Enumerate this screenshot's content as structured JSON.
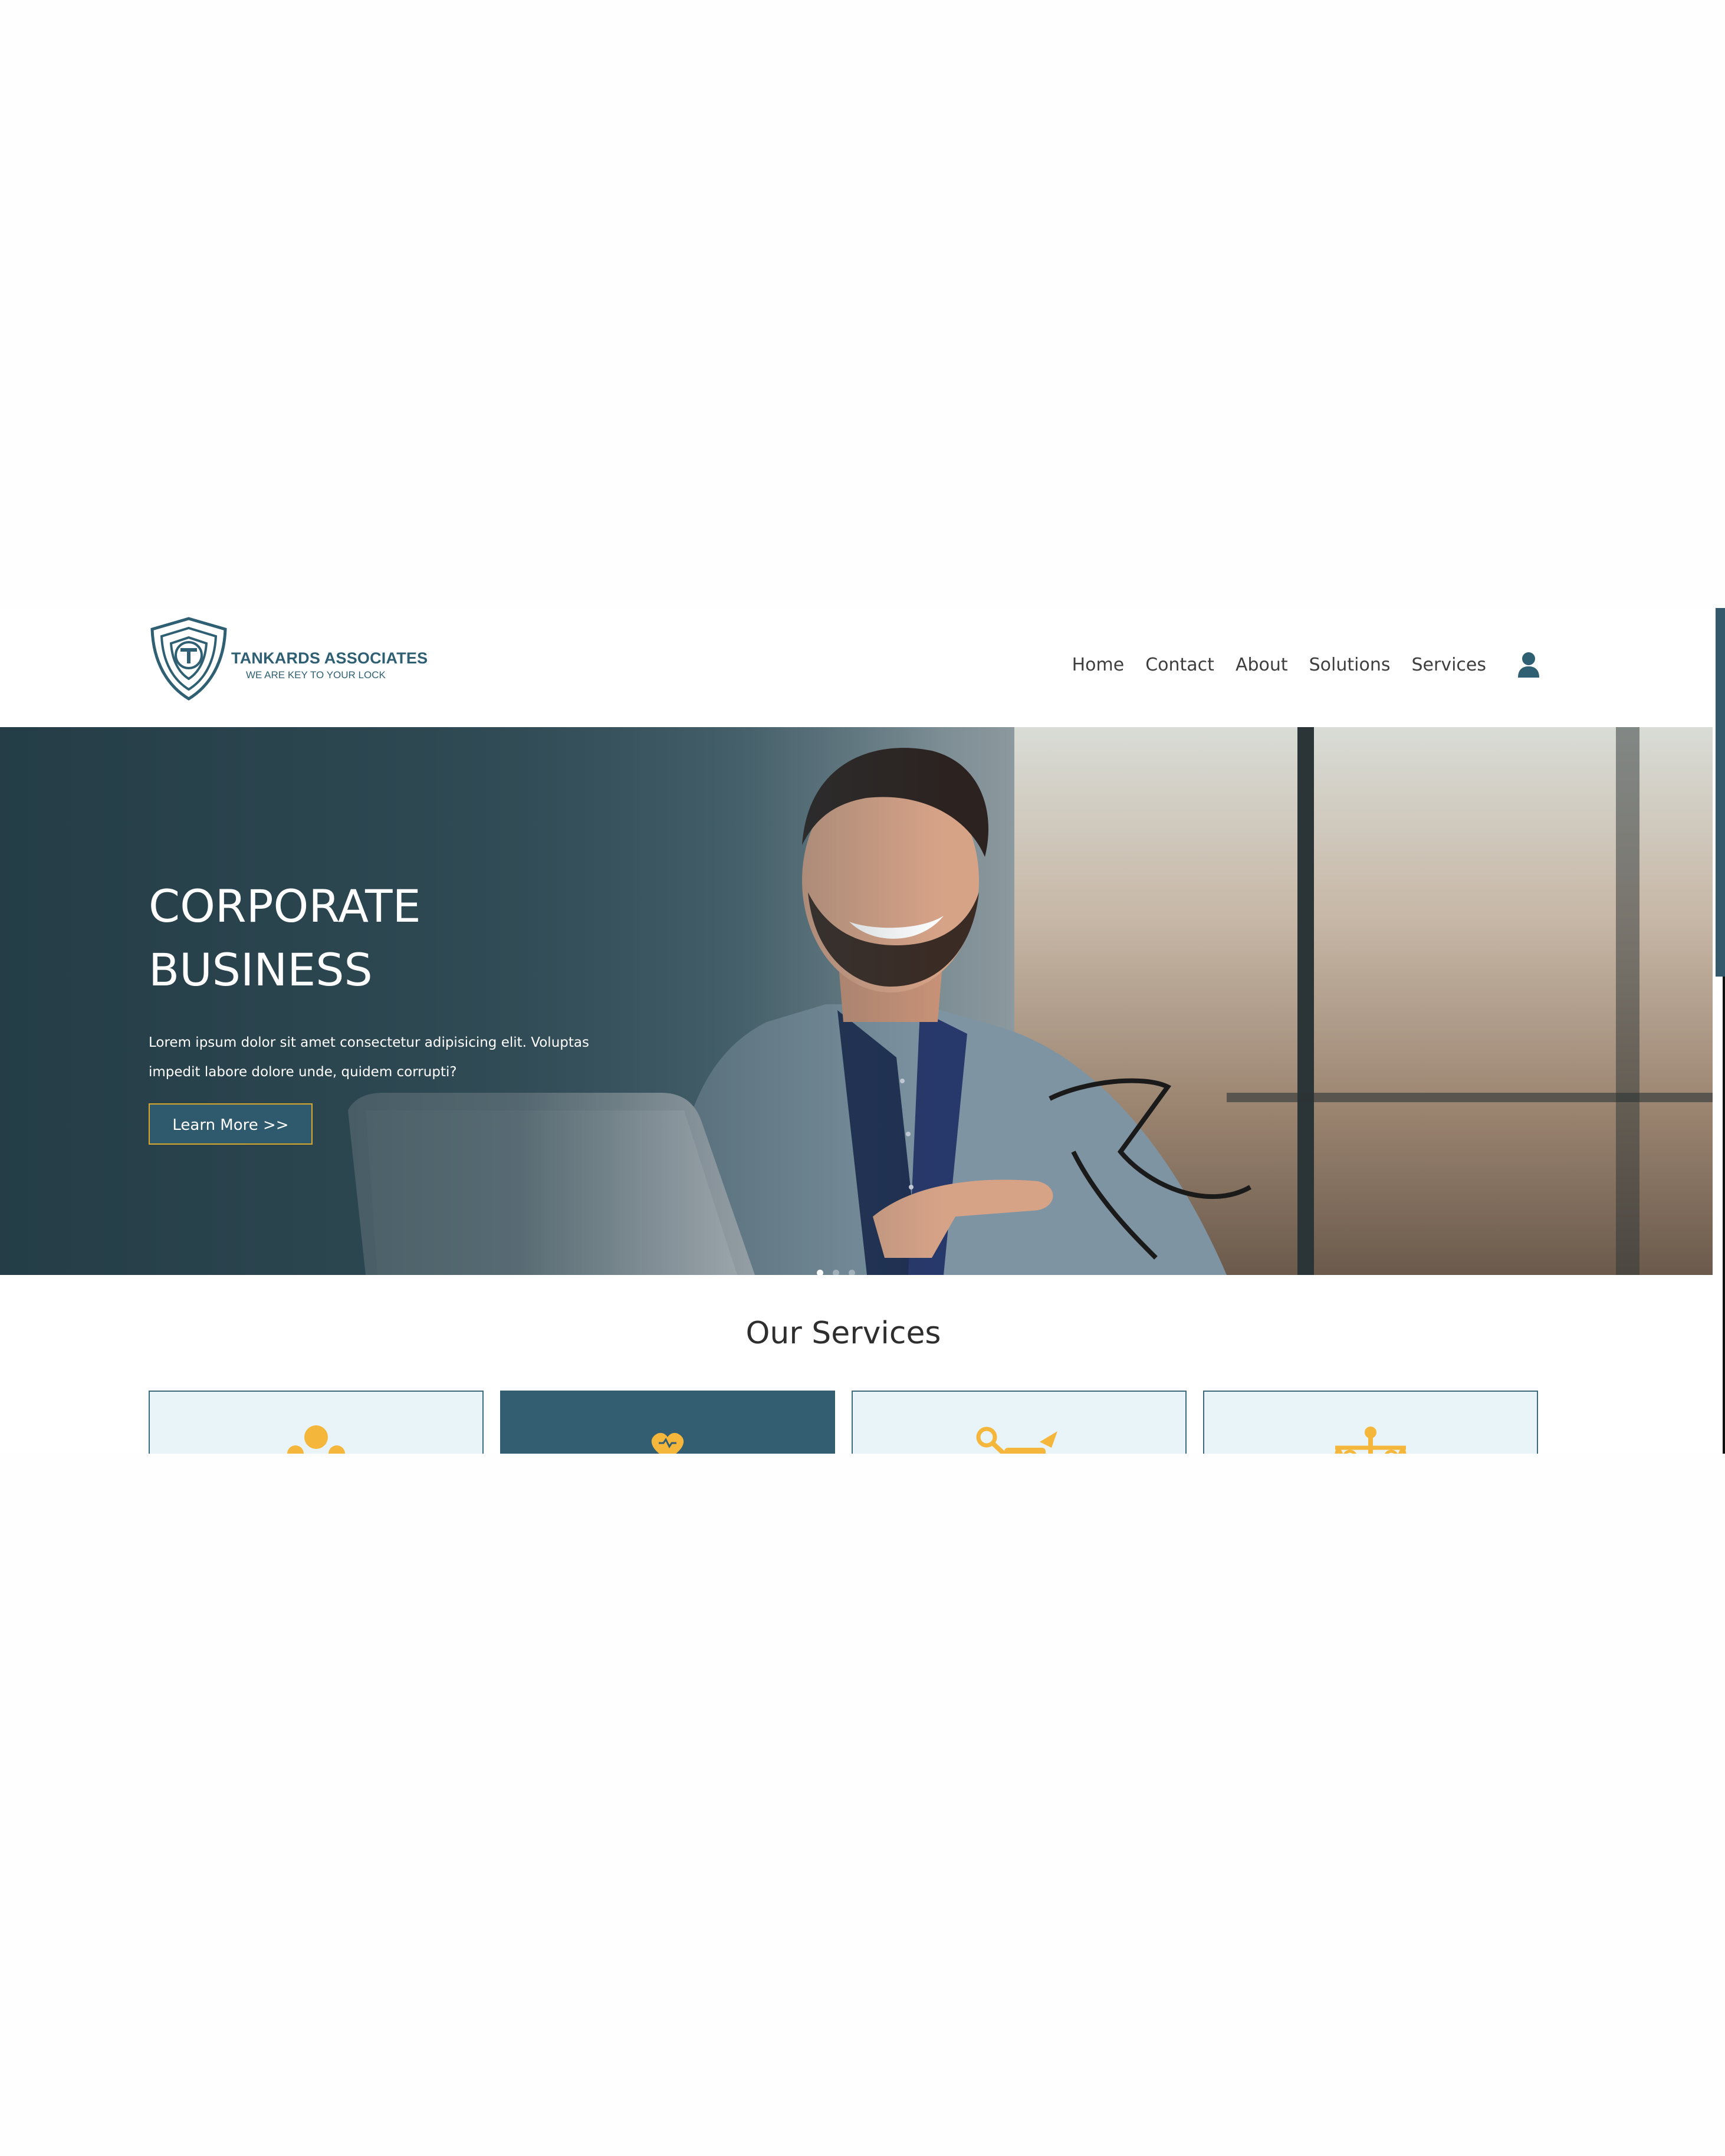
{
  "header": {
    "logo": {
      "name": "TANKARDS ASSOCIATES",
      "tagline": "WE ARE KEY TO YOUR LOCK",
      "icon": "shield-t-logo"
    },
    "nav": [
      {
        "label": "Home"
      },
      {
        "label": "Contact"
      },
      {
        "label": "About"
      },
      {
        "label": "Solutions"
      },
      {
        "label": "Services"
      }
    ],
    "user_icon": "user-icon"
  },
  "hero": {
    "title_line1": "CORPORATE",
    "title_line2": "BUSINESS",
    "text": "Lorem ipsum dolor sit amet consectetur adipisicing elit. Voluptas impedit labore dolore unde, quidem corrupti?",
    "button_label": "Learn More >>",
    "slide_count": 3,
    "active_slide": 1
  },
  "services": {
    "title": "Our Services",
    "cards": [
      {
        "icon": "team-icon",
        "active": false
      },
      {
        "icon": "heart-hands-icon",
        "active": true
      },
      {
        "icon": "tools-icon",
        "active": false
      },
      {
        "icon": "people-scale-icon",
        "active": false
      }
    ]
  },
  "colors": {
    "brand": "#2f5f73",
    "accent": "#f4b73c",
    "button_border": "#d9a62e",
    "card_bg": "#e8f4f8",
    "card_active_bg": "#335e72"
  }
}
